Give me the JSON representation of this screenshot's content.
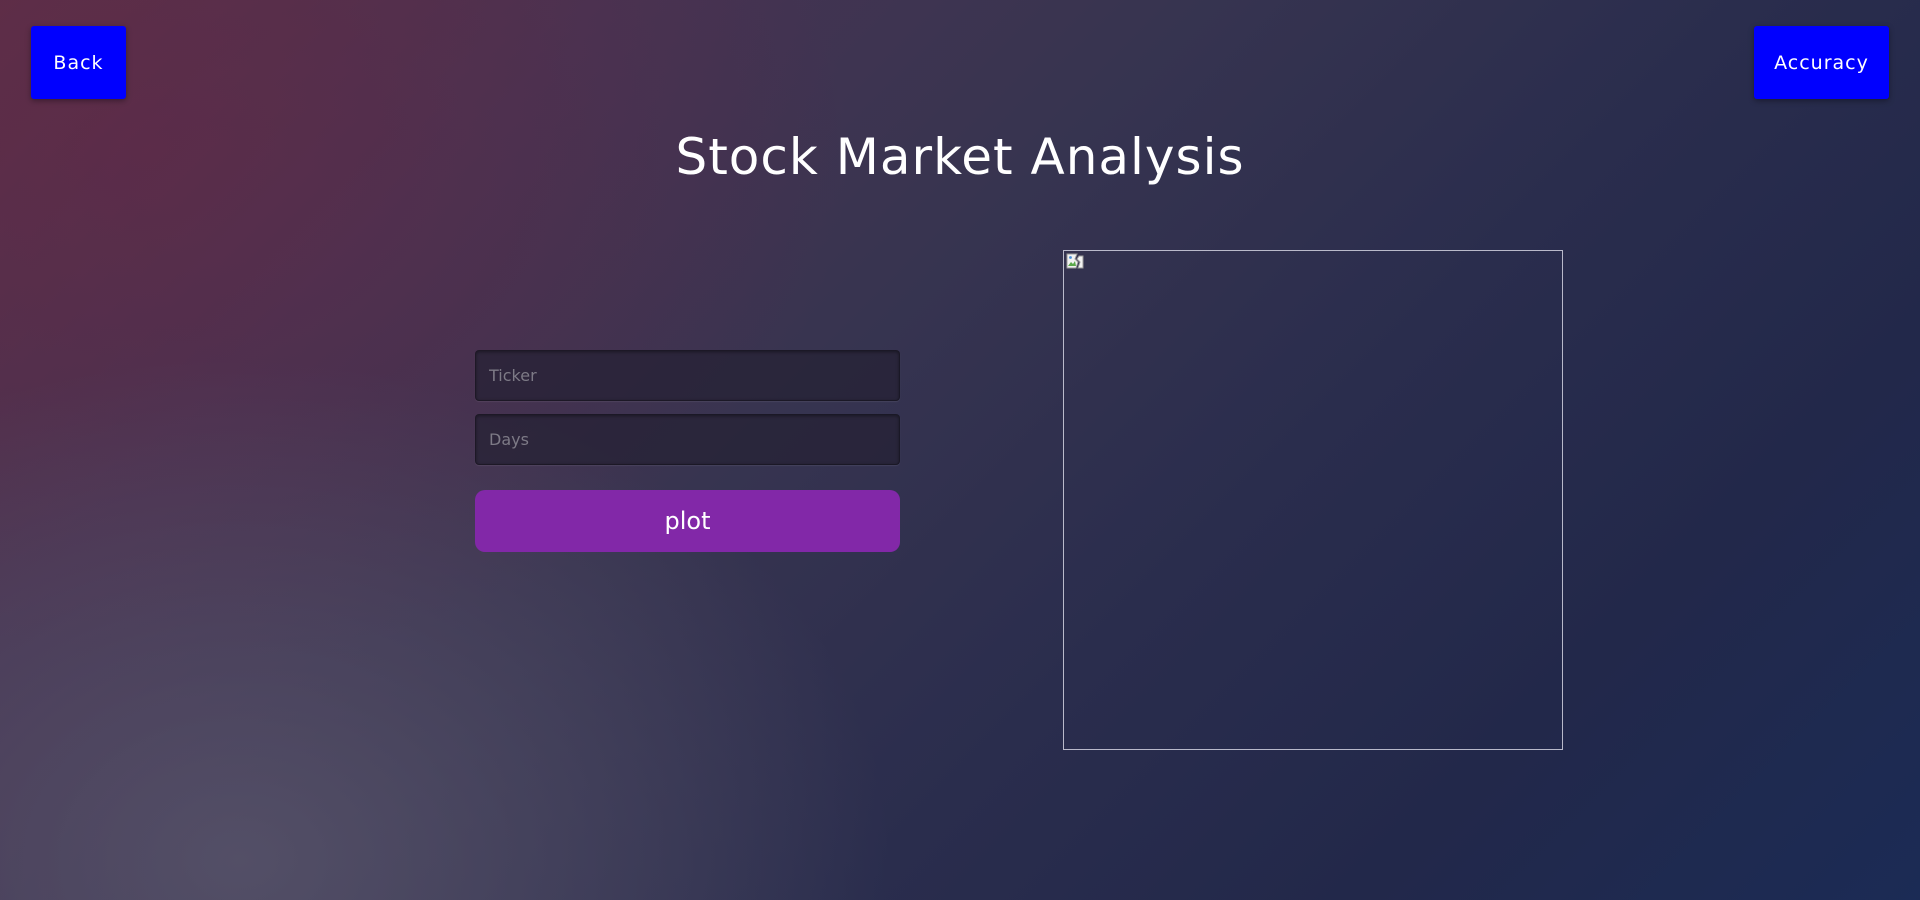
{
  "header": {
    "back_label": "Back",
    "accuracy_label": "Accuracy",
    "title": "Stock Market Analysis"
  },
  "form": {
    "ticker_placeholder": "Ticker",
    "ticker_value": "",
    "days_placeholder": "Days",
    "days_value": "",
    "plot_label": "plot"
  },
  "plot_image": {
    "icon": "broken-image-icon"
  },
  "colors": {
    "nav_button": "#0000ff",
    "plot_button": "#8228a8",
    "text": "#ffffff"
  }
}
